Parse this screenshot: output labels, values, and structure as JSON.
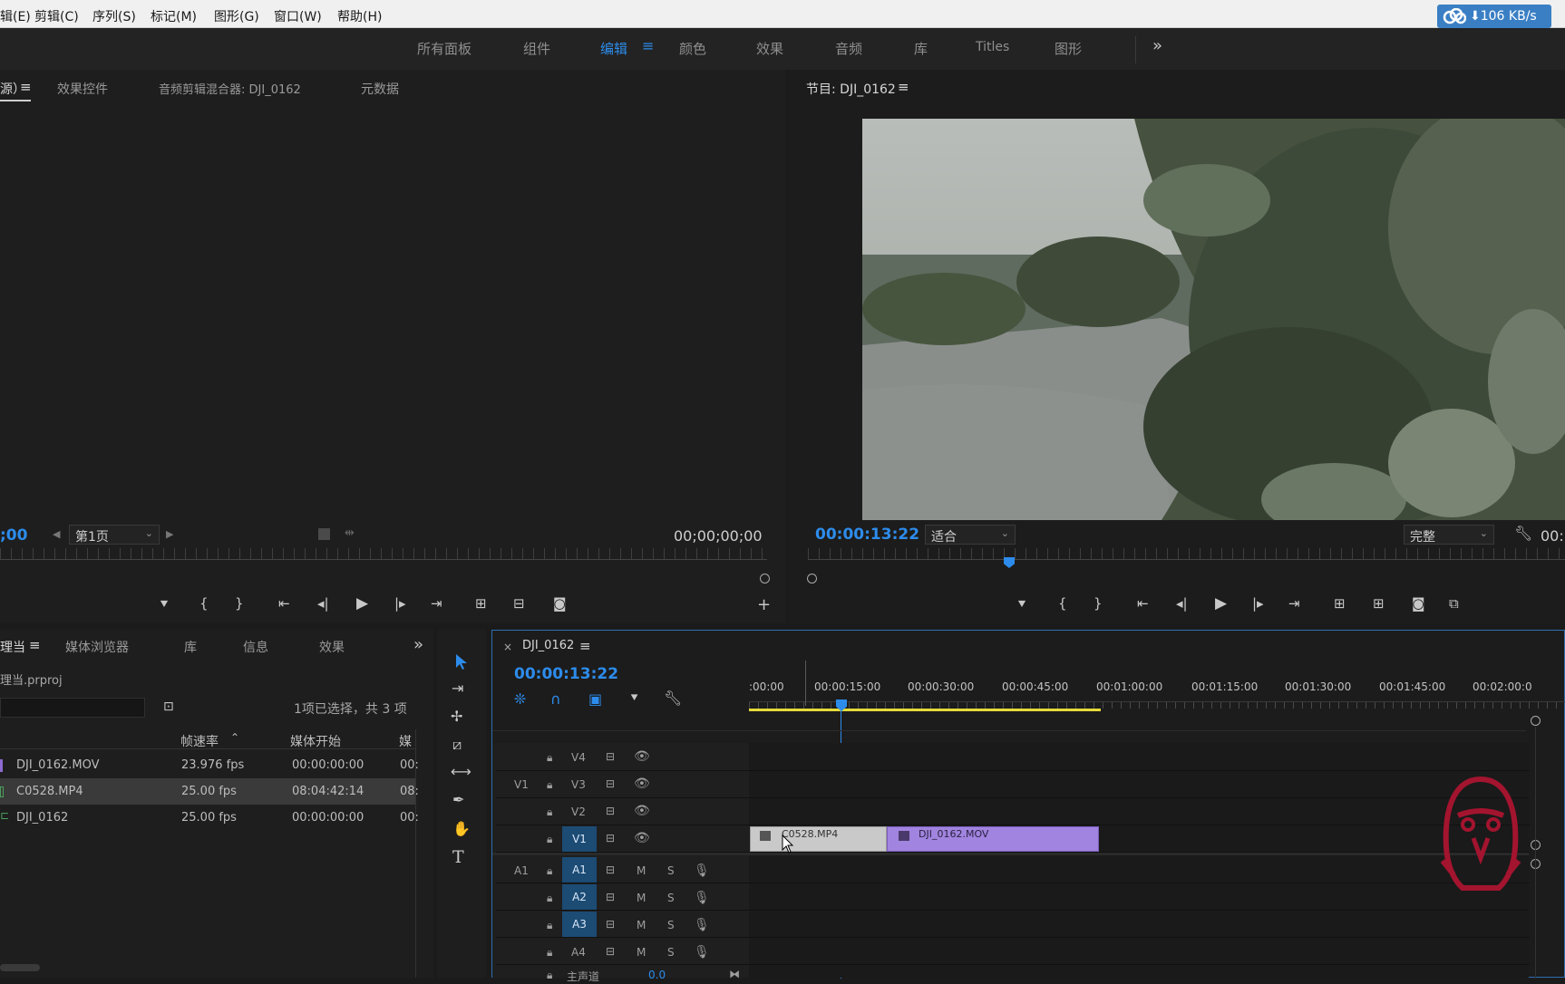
{
  "menu": [
    "辑(E)",
    "剪辑(C)",
    "序列(S)",
    "标记(M)",
    "图形(G)",
    "窗口(W)",
    "帮助(H)"
  ],
  "net_speed": "⬇106 KB/s",
  "workspaces": [
    "所有面板",
    "组件",
    "编辑",
    "颜色",
    "效果",
    "音频",
    "库",
    "Titles",
    "图形"
  ],
  "active_workspace": "编辑",
  "source_panel": {
    "tabs": [
      "源）",
      "效果控件",
      "音频剪辑混合器: DJI_0162",
      "元数据"
    ],
    "timecode_left": ";00",
    "page_select": "第1页",
    "timecode_right": "00;00;00;00"
  },
  "program_panel": {
    "title": "节目: DJI_0162",
    "timecode": "00:00:13:22",
    "fit": "适合",
    "quality": "完整",
    "tc_right": "00:"
  },
  "project_panel": {
    "tabs": [
      "理当",
      "媒体浏览器",
      "库",
      "信息",
      "效果"
    ],
    "project_name": "理当.prproj",
    "selection_info": "1项已选择，共 3 项",
    "columns": [
      "帧速率",
      "媒体开始",
      "媒"
    ],
    "rows": [
      {
        "name": "DJI_0162.MOV",
        "fps": "23.976 fps",
        "start": "00:00:00:00",
        "extra": "00:",
        "color": "#8d6bd1"
      },
      {
        "name": "C0528.MP4",
        "fps": "25.00 fps",
        "start": "08:04:42:14",
        "extra": "08:",
        "color": "#4aa05c"
      },
      {
        "name": "DJI_0162",
        "fps": "25.00 fps",
        "start": "00:00:00:00",
        "extra": "00:",
        "color": "#4aa05c"
      }
    ]
  },
  "timeline": {
    "sequence": "DJI_0162",
    "timecode": "00:00:13:22",
    "ruler": [
      ":00:00",
      "00:00:15:00",
      "00:00:30:00",
      "00:00:45:00",
      "00:01:00:00",
      "00:01:15:00",
      "00:01:30:00",
      "00:01:45:00",
      "00:02:00:0"
    ],
    "video_tracks": [
      "V4",
      "V3",
      "V2",
      "V1"
    ],
    "audio_tracks": [
      "A1",
      "A2",
      "A3",
      "A4"
    ],
    "v_label": "V1",
    "a_label": "A1",
    "mute": "M",
    "solo": "S",
    "master": "主声道",
    "master_value": "0.0",
    "clips": [
      {
        "name": "C0528.MP4",
        "color": "#c9c9c9"
      },
      {
        "name": "DJI_0162.MOV",
        "color": "#a184df"
      }
    ]
  },
  "colors": {
    "accent": "#2d8ceb",
    "clip_purple": "#a184df",
    "work_area": "#e5d93a",
    "logo": "#a3142f"
  }
}
